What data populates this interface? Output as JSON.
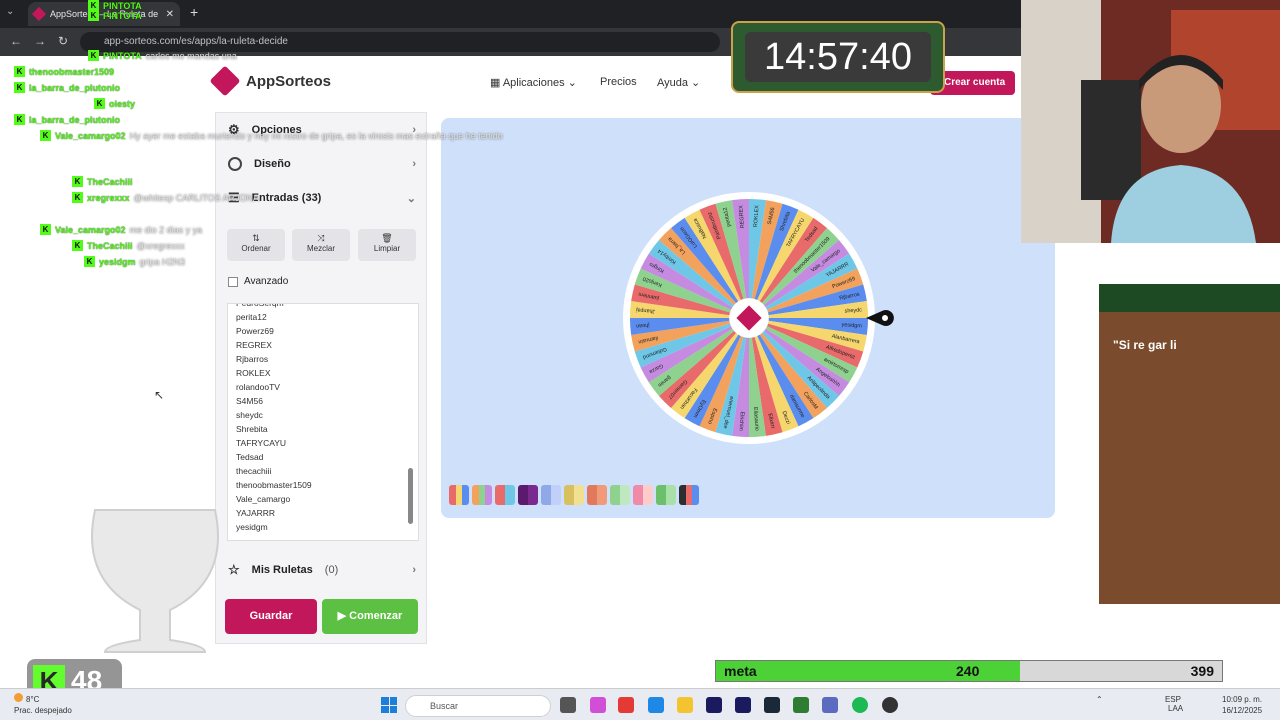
{
  "browser": {
    "tab_title": "AppSorteos – La Ruleta de la Su",
    "url": "app-sorteos.com/es/apps/la-ruleta-decide"
  },
  "site": {
    "brand": "AppSorteos",
    "nav": {
      "aplicaciones": "Aplicaciones",
      "precios": "Precios",
      "ayuda": "Ayuda"
    },
    "crear_cuenta": "Crear cuenta",
    "accent": "#c2185b"
  },
  "panel": {
    "opciones": "Opciones",
    "diseno": "Diseño",
    "entradas": "Entradas (33)",
    "tools": {
      "ordenar": "Ordenar",
      "mezclar": "Mezclar",
      "limpiar": "Limpiar"
    },
    "avanzado": "Avanzado",
    "names": [
      "PedroSerqm",
      "perita12",
      "Powerz69",
      "REGREX",
      "Rjbarros",
      "ROKLEX",
      "rolandooTV",
      "S4M56",
      "sheydc",
      "Shrebita",
      "TAFRYCAYU",
      "Tedsad",
      "thecachiii",
      "thenoobmaster1509",
      "Vale_camargo",
      "YAJARRR",
      "yesidgm"
    ],
    "mis_ruletas": "Mis Ruletas",
    "mis_ruletas_count": "(0)",
    "guardar": "Guardar",
    "comenzar": "Comenzar"
  },
  "wheel": {
    "segment_colors": [
      "#5b8def",
      "#f5d76e",
      "#e86a6a",
      "#8fd18f",
      "#c58be0",
      "#6fc7e8",
      "#f2a25c"
    ],
    "labels": [
      "yesidgm",
      "Alanbarrera",
      "Alfredoperez",
      "amirtorresp",
      "Angeloshhh",
      "Anlipeolinda",
      "CarlosM",
      "danisurme",
      "Dezzi",
      "Elixirrr",
      "Ellasaurio",
      "Elrichim",
      "enemuel_dee",
      "Espino",
      "EyOmm",
      "FacuKhan",
      "Gamerr07",
      "ganim",
      "Garza",
      "Gdiamond",
      "ilamusin",
      "jhoan",
      "Jhanpaj",
      "juanrlem",
      "Kenjo20",
      "Kingro",
      "Kimby14",
      "La_barra",
      "LuiGGeon",
      "NaBusca",
      "Paintbrushz",
      "perita12",
      "REGREX",
      "ROKLEX",
      "S4M56",
      "Shrebita",
      "TAFRYCAYU",
      "Tedsad",
      "thenoobmaster1509",
      "Vale_camargo",
      "YAJARRR",
      "Powerz69",
      "Rjbarros",
      "sheydc"
    ]
  },
  "stream": {
    "chat": [
      {
        "user": "PINTOTA",
        "msg": ""
      },
      {
        "user": "PINTOTA",
        "msg": ""
      },
      {
        "user": "PINTOTA",
        "msg": "carlos me mandas una"
      },
      {
        "user": "thenoobmaster1509",
        "msg": ""
      },
      {
        "user": "la_barra_de_plutonio",
        "msg": ""
      },
      {
        "user": "oiesty",
        "msg": ""
      },
      {
        "user": "la_barra_de_plutonio",
        "msg": ""
      },
      {
        "user": "Vale_camargo02",
        "msg": "Hy ayer me estaba muriendo y hoy mi rostro de gripa, es la virosis mas extraña que he tenido"
      },
      {
        "user": "TheCachiii",
        "msg": ""
      },
      {
        "user": "xregrexxx",
        "msg": "@whitesp CARLITOS ARJONA"
      },
      {
        "user": "Vale_camargo02",
        "msg": "me dio 2 dias y ya"
      },
      {
        "user": "TheCachiii",
        "msg": "@xregrexxx"
      },
      {
        "user": "yesidgm",
        "msg": "gripa H2N3"
      }
    ],
    "clock": "14:57:40",
    "card_quote": "\"Si re gar li",
    "kick_count": "48",
    "goal": {
      "label": "meta",
      "current": 240,
      "max": 399
    }
  },
  "taskbar": {
    "weather_temp": "8°C",
    "weather_text": "Prac. despejado",
    "search": "Buscar",
    "lang": "ESP",
    "lang2": "LAA",
    "time": "10:09 p. m.",
    "date": "16/12/2025"
  }
}
